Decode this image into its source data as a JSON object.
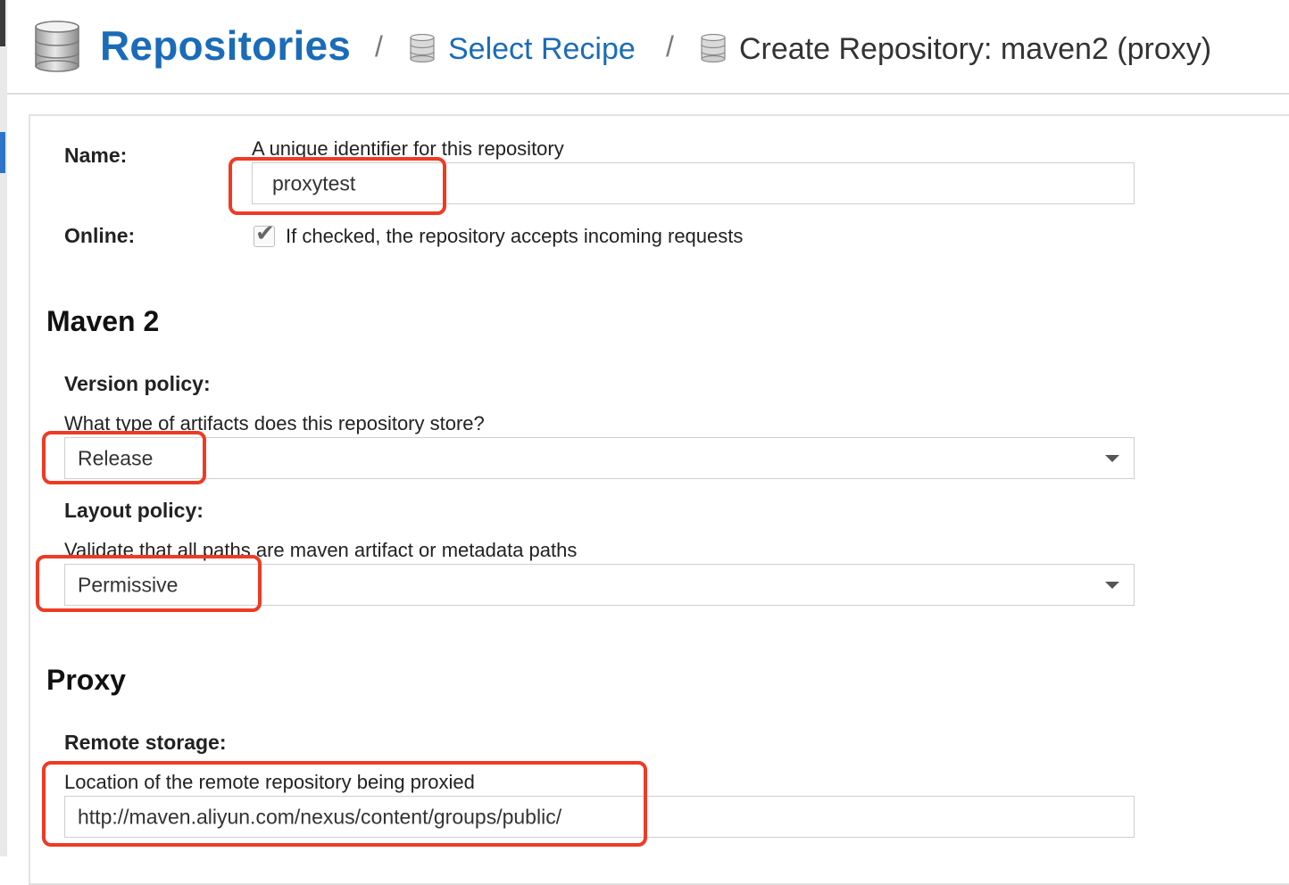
{
  "breadcrumb": {
    "root": "Repositories",
    "separator": "/",
    "step1": "Select Recipe",
    "current": "Create Repository: maven2 (proxy)"
  },
  "form": {
    "name": {
      "label": "Name:",
      "hint": "A unique identifier for this repository",
      "value": "proxytest"
    },
    "online": {
      "label": "Online:",
      "checked": true,
      "hint": "If checked, the repository accepts incoming requests"
    }
  },
  "maven": {
    "title": "Maven 2",
    "version_policy": {
      "label": "Version policy:",
      "hint": "What type of artifacts does this repository store?",
      "value": "Release"
    },
    "layout_policy": {
      "label": "Layout policy:",
      "hint": "Validate that all paths are maven artifact or metadata paths",
      "value": "Permissive"
    }
  },
  "proxy": {
    "title": "Proxy",
    "remote_storage": {
      "label": "Remote storage:",
      "hint": "Location of the remote repository being proxied",
      "value": "http://maven.aliyun.com/nexus/content/groups/public/"
    }
  },
  "colors": {
    "link": "#1a6cb8",
    "highlight": "#ee3b24",
    "active_nav": "#2b74c7"
  },
  "icons": {
    "breadcrumb": "database-icon",
    "dropdown": "chevron-down-icon",
    "check": "checkmark-icon"
  }
}
